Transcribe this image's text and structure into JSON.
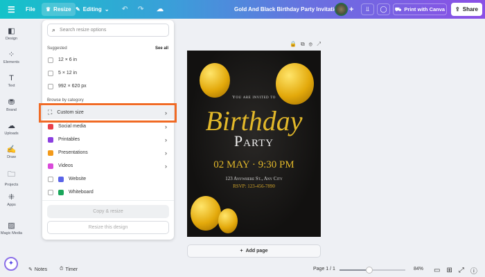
{
  "topbar": {
    "file": "File",
    "resize": "Resize",
    "editing": "Editing",
    "title": "Gold And Black Birthday Party Invitation",
    "print": "Print with Canva",
    "share": "Share"
  },
  "sidebar": [
    "Design",
    "Elements",
    "Text",
    "Brand",
    "Uploads",
    "Draw",
    "Projects",
    "Apps",
    "Magic Media"
  ],
  "resize_panel": {
    "search_placeholder": "Search resize options",
    "suggested": "Suggested",
    "see_all": "See all",
    "suggestions": [
      "12 × 6 in",
      "5 × 12 in",
      "992 × 620 px"
    ],
    "browse": "Browse by category",
    "categories": [
      {
        "label": "Custom size",
        "color": "#333333"
      },
      {
        "label": "Social media",
        "color": "#e8404a"
      },
      {
        "label": "Printables",
        "color": "#8b3fe0"
      },
      {
        "label": "Presentations",
        "color": "#f39a1b"
      },
      {
        "label": "Videos",
        "color": "#d94ad9"
      }
    ],
    "checkbox_categories": [
      {
        "label": "Website",
        "color": "#5a64e8"
      },
      {
        "label": "Whiteboard",
        "color": "#1aa65a"
      }
    ],
    "copy_resize": "Copy & resize",
    "resize_design": "Resize this design"
  },
  "design": {
    "invited": "You are invited to",
    "birthday": "Birthday",
    "party": "Party",
    "date": "02 MAY · 9:30 PM",
    "address": "123 Anywhere St., Any City",
    "rsvp": "RSVP: 123-456-7890"
  },
  "add_page": "Add page",
  "bottom": {
    "notes": "Notes",
    "timer": "Timer",
    "page": "Page 1 / 1",
    "zoom": "84%",
    "zoom_fraction": 0.45
  }
}
